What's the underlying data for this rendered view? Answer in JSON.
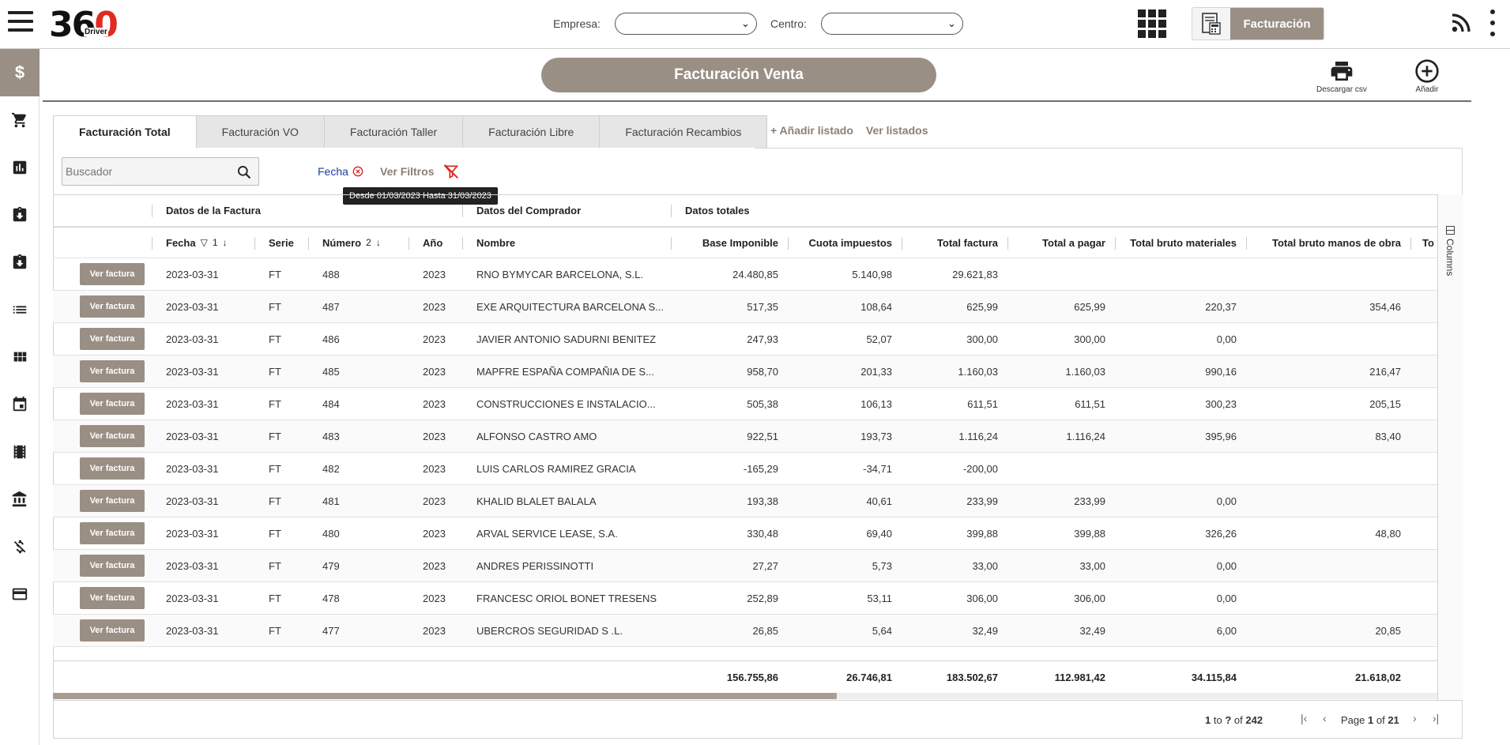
{
  "app": {
    "logo_text": "36",
    "logo_zero": "0",
    "logo_sub": "Driver",
    "empresa_label": "Empresa:",
    "empresa_value": "",
    "centro_label": "Centro:",
    "centro_value": "",
    "module_label": "Facturación"
  },
  "sidebar": {
    "active_symbol": "$",
    "items": [
      "dollar-icon",
      "cart-icon",
      "bar-chart-icon",
      "clipboard-in-icon",
      "clipboard-out-icon",
      "list-icon",
      "apps-icon",
      "calendar-icon",
      "film-icon",
      "bank-icon",
      "money-off-icon",
      "credit-card-icon"
    ]
  },
  "page": {
    "title": "Facturación Venta",
    "download_label": "Descargar csv",
    "add_label": "Añadir"
  },
  "tabs": [
    {
      "label": "Facturación Total",
      "active": true
    },
    {
      "label": "Facturación VO",
      "active": false
    },
    {
      "label": "Facturación Taller",
      "active": false
    },
    {
      "label": "Facturación Libre",
      "active": false
    },
    {
      "label": "Facturación Recambios",
      "active": false
    }
  ],
  "tab_links": {
    "add": "+ Añadir listado",
    "view": "Ver listados"
  },
  "filters": {
    "search_placeholder": "Buscador",
    "fecha": "Fecha",
    "ver_filtros": "Ver Filtros",
    "tooltip": "Desde 01/03/2023 Hasta 31/03/2023"
  },
  "grid": {
    "groups": {
      "factura": "Datos de la Factura",
      "comprador": "Datos del Comprador",
      "totales": "Datos totales"
    },
    "columns": {
      "fecha": "Fecha",
      "fecha_sort": "1",
      "serie": "Serie",
      "numero": "Número",
      "numero_sort": "2",
      "anio": "Año",
      "nombre": "Nombre",
      "base": "Base Imponible",
      "cuota": "Cuota impuestos",
      "total": "Total factura",
      "pagar": "Total a pagar",
      "materiales": "Total bruto materiales",
      "mano": "Total bruto manos de obra",
      "next": "To"
    },
    "row_button": "Ver factura",
    "side_panel": "Columns",
    "rows": [
      {
        "fecha": "2023-03-31",
        "serie": "FT",
        "numero": "488",
        "anio": "2023",
        "nombre": "RNO BYMYCAR BARCELONA, S.L.",
        "base": "24.480,85",
        "cuota": "5.140,98",
        "total": "29.621,83",
        "pagar": "",
        "materiales": "",
        "mano": ""
      },
      {
        "fecha": "2023-03-31",
        "serie": "FT",
        "numero": "487",
        "anio": "2023",
        "nombre": "EXE ARQUITECTURA BARCELONA S...",
        "base": "517,35",
        "cuota": "108,64",
        "total": "625,99",
        "pagar": "625,99",
        "materiales": "220,37",
        "mano": "354,46"
      },
      {
        "fecha": "2023-03-31",
        "serie": "FT",
        "numero": "486",
        "anio": "2023",
        "nombre": "JAVIER ANTONIO SADURNI BENITEZ",
        "base": "247,93",
        "cuota": "52,07",
        "total": "300,00",
        "pagar": "300,00",
        "materiales": "0,00",
        "mano": ""
      },
      {
        "fecha": "2023-03-31",
        "serie": "FT",
        "numero": "485",
        "anio": "2023",
        "nombre": "MAPFRE ESPAÑA COMPAÑIA DE S...",
        "base": "958,70",
        "cuota": "201,33",
        "total": "1.160,03",
        "pagar": "1.160,03",
        "materiales": "990,16",
        "mano": "216,47"
      },
      {
        "fecha": "2023-03-31",
        "serie": "FT",
        "numero": "484",
        "anio": "2023",
        "nombre": "CONSTRUCCIONES E INSTALACIO...",
        "base": "505,38",
        "cuota": "106,13",
        "total": "611,51",
        "pagar": "611,51",
        "materiales": "300,23",
        "mano": "205,15"
      },
      {
        "fecha": "2023-03-31",
        "serie": "FT",
        "numero": "483",
        "anio": "2023",
        "nombre": "ALFONSO CASTRO AMO",
        "base": "922,51",
        "cuota": "193,73",
        "total": "1.116,24",
        "pagar": "1.116,24",
        "materiales": "395,96",
        "mano": "83,40"
      },
      {
        "fecha": "2023-03-31",
        "serie": "FT",
        "numero": "482",
        "anio": "2023",
        "nombre": "LUIS CARLOS RAMIREZ GRACIA",
        "base": "-165,29",
        "cuota": "-34,71",
        "total": "-200,00",
        "pagar": "",
        "materiales": "",
        "mano": ""
      },
      {
        "fecha": "2023-03-31",
        "serie": "FT",
        "numero": "481",
        "anio": "2023",
        "nombre": "KHALID BLALET BALALA",
        "base": "193,38",
        "cuota": "40,61",
        "total": "233,99",
        "pagar": "233,99",
        "materiales": "0,00",
        "mano": ""
      },
      {
        "fecha": "2023-03-31",
        "serie": "FT",
        "numero": "480",
        "anio": "2023",
        "nombre": "ARVAL SERVICE LEASE, S.A.",
        "base": "330,48",
        "cuota": "69,40",
        "total": "399,88",
        "pagar": "399,88",
        "materiales": "326,26",
        "mano": "48,80"
      },
      {
        "fecha": "2023-03-31",
        "serie": "FT",
        "numero": "479",
        "anio": "2023",
        "nombre": "ANDRES PERISSINOTTI",
        "base": "27,27",
        "cuota": "5,73",
        "total": "33,00",
        "pagar": "33,00",
        "materiales": "0,00",
        "mano": ""
      },
      {
        "fecha": "2023-03-31",
        "serie": "FT",
        "numero": "478",
        "anio": "2023",
        "nombre": "FRANCESC ORIOL BONET TRESENS",
        "base": "252,89",
        "cuota": "53,11",
        "total": "306,00",
        "pagar": "306,00",
        "materiales": "0,00",
        "mano": ""
      },
      {
        "fecha": "2023-03-31",
        "serie": "FT",
        "numero": "477",
        "anio": "2023",
        "nombre": "UBERCROS SEGURIDAD S .L.",
        "base": "26,85",
        "cuota": "5,64",
        "total": "32,49",
        "pagar": "32,49",
        "materiales": "6,00",
        "mano": "20,85"
      }
    ],
    "totals": {
      "base": "156.755,86",
      "cuota": "26.746,81",
      "total": "183.502,67",
      "pagar": "112.981,42",
      "materiales": "34.115,84",
      "mano": "21.618,02"
    }
  },
  "pager": {
    "from": "1",
    "to_word": "to",
    "to": "?",
    "of_word": "of",
    "count": "242",
    "page_word": "Page",
    "page": "1",
    "pages": "21"
  },
  "colors": {
    "accent": "#9a8f84",
    "link": "#1d3d9e",
    "logo_red": "#e02b20"
  }
}
